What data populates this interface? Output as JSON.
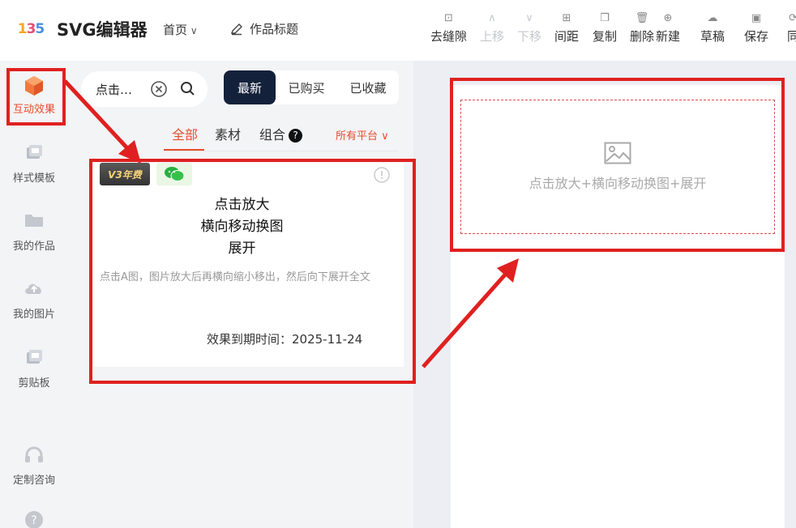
{
  "header": {
    "logo_text": "135",
    "app_title": "SVG编辑器",
    "nav_home": "首页",
    "doc_title": "作品标题",
    "tools": [
      {
        "label": "去缝隙",
        "icon": "gap-icon",
        "disabled": false
      },
      {
        "label": "上移",
        "icon": "chevron-up-icon",
        "disabled": true
      },
      {
        "label": "下移",
        "icon": "chevron-down-icon",
        "disabled": true
      },
      {
        "label": "间距",
        "icon": "spacing-icon",
        "disabled": false
      },
      {
        "label": "复制",
        "icon": "copy-icon",
        "disabled": false
      },
      {
        "label": "删除",
        "icon": "trash-icon",
        "disabled": false
      },
      {
        "label": "新建",
        "icon": "new-file-icon",
        "disabled": false
      },
      {
        "label": "草稿",
        "icon": "cloud-icon",
        "disabled": false
      },
      {
        "label": "保存",
        "icon": "save-icon",
        "disabled": false
      },
      {
        "label": "同",
        "icon": "sync-icon",
        "disabled": false
      }
    ]
  },
  "rail": {
    "items": [
      {
        "label": "互动效果",
        "icon": "cube-icon",
        "active": true
      },
      {
        "label": "样式模板",
        "icon": "template-icon",
        "active": false
      },
      {
        "label": "我的作品",
        "icon": "folder-icon",
        "active": false
      },
      {
        "label": "我的图片",
        "icon": "cloud-upload-icon",
        "active": false
      },
      {
        "label": "剪贴板",
        "icon": "clipboard-icon",
        "active": false
      },
      {
        "label": "定制咨询",
        "icon": "headset-icon",
        "active": false
      }
    ]
  },
  "panel": {
    "search_value": "点击…",
    "tabs": [
      "最新",
      "已购买",
      "已收藏"
    ],
    "subtabs": [
      "全部",
      "素材",
      "组合"
    ],
    "help_mark": "?",
    "platform_filter": "所有平台",
    "card": {
      "badge": "V3年费",
      "title_lines": [
        "点击放大",
        "横向移动换图",
        "展开"
      ],
      "description": "点击A图，图片放大后再横向缩小移出，然后向下展开全文",
      "expire": "效果到期时间：2025-11-24"
    }
  },
  "canvas": {
    "placeholder_text": "点击放大+横向移动换图+展开"
  },
  "colors": {
    "accent": "#e84d2a",
    "annotation_red": "#e02020",
    "tab_active_bg": "#14213b"
  }
}
